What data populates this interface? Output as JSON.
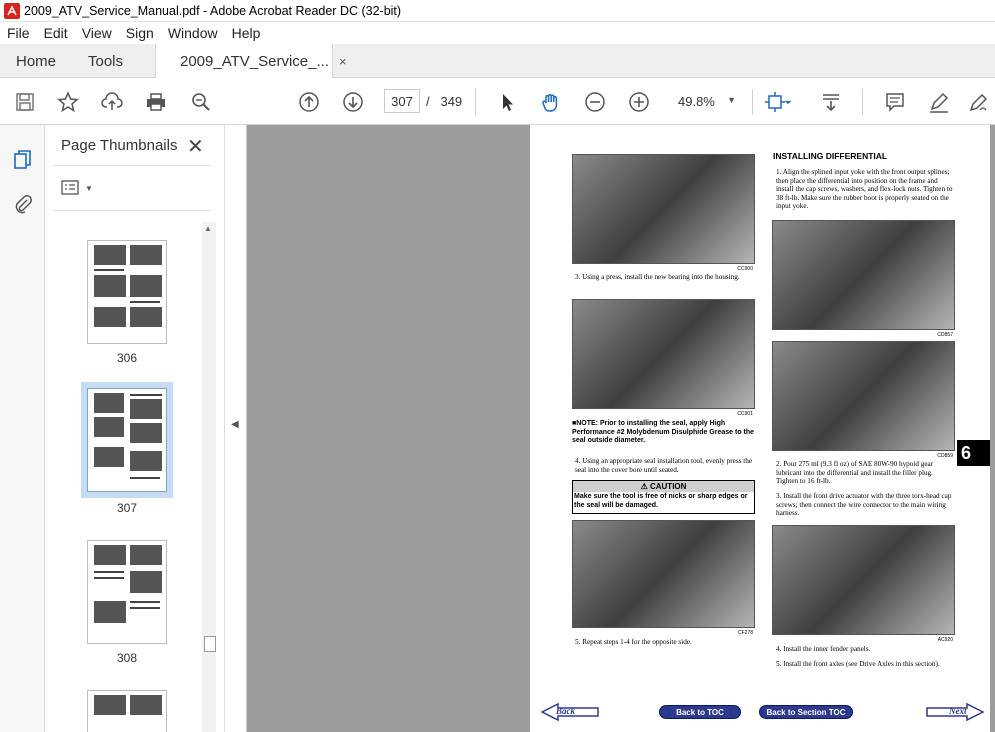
{
  "window": {
    "title": "2009_ATV_Service_Manual.pdf - Adobe Acrobat Reader DC (32-bit)"
  },
  "menu": [
    "File",
    "Edit",
    "View",
    "Sign",
    "Window",
    "Help"
  ],
  "tabs": {
    "home": "Home",
    "tools": "Tools",
    "doc": "2009_ATV_Service_...",
    "close": "×"
  },
  "toolbar": {
    "page_current": "307",
    "page_sep": "/",
    "page_total": "349",
    "zoom": "49.8%"
  },
  "panel": {
    "title": "Page Thumbnails",
    "close": "✕",
    "thumbnails": [
      {
        "label": "306"
      },
      {
        "label": "307",
        "selected": true
      },
      {
        "label": "308"
      }
    ]
  },
  "pdf": {
    "left": {
      "img1_code": "CC900",
      "step3": "3.  Using a press, install the new bearing into the housing.",
      "img2_code": "CC901",
      "note": "■NOTE: Prior to installing the seal, apply High Performance #2 Molybdenum Disulphide Grease to the seal outside diameter.",
      "step4": "4.  Using an appropriate seal installation tool, evenly press the seal into the cover bore until seated.",
      "caution_title": "⚠ CAUTION",
      "caution_text": "Make sure the tool is free of nicks or sharp edges or the seal will be damaged.",
      "img3_code": "CF278",
      "step5": "5.  Repeat steps 1-4 for the opposite side."
    },
    "right": {
      "heading": "INSTALLING DIFFERENTIAL",
      "step1": "1.  Align the splined input yoke with the front output splines; then place the differential into position on the frame and install the cap screws, washers, and flex-lock nuts. Tighten to 38 ft-lb. Make sure the rubber boot is properly seated on the input yoke.",
      "img1_code": "CD857",
      "img2_code": "CD859",
      "step2": "2.  Pour 275 ml (9.3 fl oz) of SAE 80W-90 hypoid gear lubricant into the differential and install the filler plug. Tighten to 16 ft-lb.",
      "step3": "3.  Install the front drive actuator with the three torx-head cap screws; then connect the wire connector to the main wiring harness.",
      "img3_code": "AC920",
      "step4": "4.  Install the inner fender panels.",
      "step5": "5.  Install the front axles (see Drive Axles in this section)."
    },
    "section_tab": "6",
    "nav": {
      "back": "Back",
      "toc": "Back to TOC",
      "section_toc": "Back to Section TOC",
      "next": "Next"
    }
  }
}
